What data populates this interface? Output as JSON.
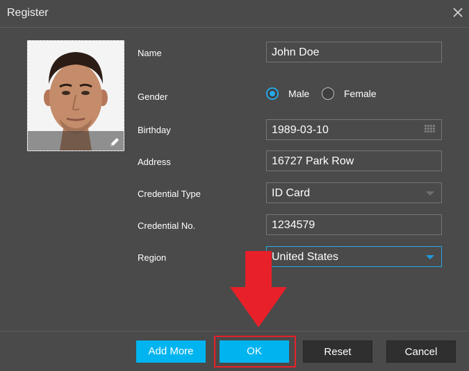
{
  "dialog": {
    "title": "Register"
  },
  "form": {
    "name_label": "Name",
    "name_value": "John Doe",
    "gender_label": "Gender",
    "gender_options": [
      "Male",
      "Female"
    ],
    "gender_selected": "Male",
    "birthday_label": "Birthday",
    "birthday_value": "1989-03-10",
    "address_label": "Address",
    "address_value": "16727 Park Row",
    "credential_type_label": "Credential Type",
    "credential_type_value": "ID Card",
    "credential_no_label": "Credential No.",
    "credential_no_value": "1234579",
    "region_label": "Region",
    "region_value": "United States"
  },
  "buttons": {
    "add_more": "Add More",
    "ok": "OK",
    "reset": "Reset",
    "cancel": "Cancel"
  },
  "colors": {
    "background": "#4a4a4a",
    "accent": "#00b4f0",
    "highlight": "#e8202a"
  },
  "icons": {
    "close": "close-icon",
    "edit": "pencil-icon",
    "calendar": "calendar-icon",
    "dropdown": "chevron-down-icon"
  }
}
